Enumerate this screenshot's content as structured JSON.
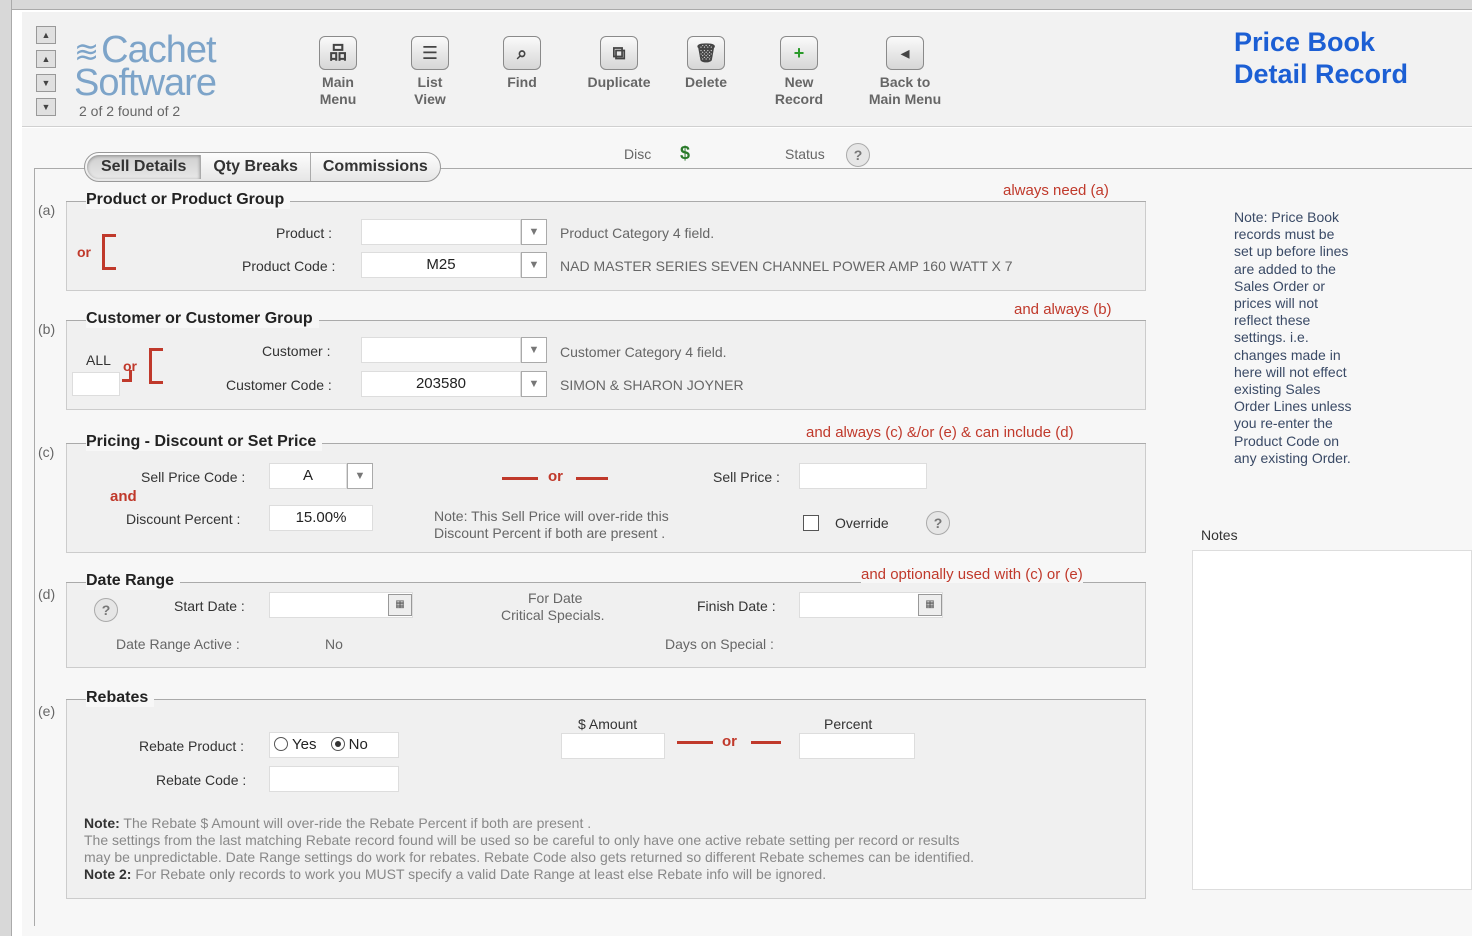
{
  "header": {
    "logo_line1": "Cachet",
    "logo_line2": "Software",
    "found_text": "2 of 2 found of 2",
    "toolbar": {
      "main_menu": [
        "Main",
        "Menu"
      ],
      "list_view": [
        "List",
        "View"
      ],
      "find": "Find",
      "duplicate": "Duplicate",
      "delete": "Delete",
      "new_record": [
        "New",
        "Record"
      ],
      "back_main_menu": [
        "Back to",
        "Main Menu"
      ]
    },
    "title_line1": "Price Book",
    "title_line2": "Detail Record",
    "disc_label": "Disc",
    "status_label": "Status"
  },
  "tabs": [
    "Sell Details",
    "Qty Breaks",
    "Commissions"
  ],
  "sections": {
    "a": {
      "tag": "(a)",
      "title": "Product or Product Group",
      "rule": "always need (a)",
      "or": "or",
      "product_label": "Product :",
      "product_value": "",
      "product_hint": "Product Category 4 field.",
      "code_label": "Product Code :",
      "code_value": "M25",
      "code_desc": "NAD MASTER SERIES SEVEN CHANNEL POWER AMP 160 WATT X 7"
    },
    "b": {
      "tag": "(b)",
      "title": "Customer or Customer Group",
      "rule": "and always (b)",
      "all_label": "ALL",
      "or": "or",
      "customer_label": "Customer :",
      "customer_value": "",
      "customer_hint": "Customer Category 4 field.",
      "code_label": "Customer Code :",
      "code_value": "203580",
      "code_desc": "SIMON & SHARON JOYNER"
    },
    "c": {
      "tag": "(c)",
      "title": "Pricing - Discount or Set Price",
      "rule": "and always (c) &/or (e) & can include (d)",
      "sell_price_code_label": "Sell Price Code :",
      "sell_price_code_value": "A",
      "and": "and",
      "discount_label": "Discount Percent :",
      "discount_value": "15.00%",
      "or": "or",
      "sell_price_label": "Sell Price :",
      "sell_price_value": "",
      "note_line1": "Note: This Sell Price will over-ride this",
      "note_line2": "Discount Percent if both are present .",
      "override_label": "Override",
      "override_checked": false
    },
    "d": {
      "tag": "(d)",
      "title": "Date Range",
      "rule": "and optionally used with (c) or (e)",
      "start_label": "Start Date :",
      "start_value": "",
      "middle_line1": "For Date",
      "middle_line2": "Critical Specials.",
      "finish_label": "Finish Date :",
      "finish_value": "",
      "active_label": "Date Range Active :",
      "active_value": "No",
      "days_label": "Days on Special :",
      "days_value": ""
    },
    "e": {
      "tag": "(e)",
      "title": "Rebates",
      "amount_label": "$ Amount",
      "amount_value": "",
      "or": "or",
      "percent_label": "Percent",
      "percent_value": "",
      "rebate_product_label": "Rebate Product :",
      "yes_label": "Yes",
      "no_label": "No",
      "rebate_product_value": "No",
      "rebate_code_label": "Rebate Code :",
      "rebate_code_value": "",
      "note_label": "Note:",
      "note_text": "The Rebate $ Amount will over-ride the Rebate Percent if both are present .",
      "note_line2": "The settings from the last matching Rebate record found will be used so be careful to only have one active rebate setting per record or results",
      "note_line3": "may be unpredictable.  Date Range settings do work for rebates.  Rebate Code also gets returned so different Rebate schemes can be identified.",
      "note2_label": "Note 2:",
      "note2_text": "For Rebate only records to work you MUST specify a valid Date Range at least else Rebate info will be ignored."
    }
  },
  "side_note": [
    "Note: Price Book",
    "records must be",
    "set up before lines",
    "are added to the",
    "Sales Order or",
    "prices will not",
    "reflect these",
    "settings. i.e.",
    "changes made in",
    "here will not effect",
    "existing Sales",
    "Order Lines unless",
    "you re-enter the",
    "Product Code on",
    "any existing Order."
  ],
  "notes_label": "Notes",
  "notes_value": "",
  "colors": {
    "title_blue": "#1c5fd4",
    "rule_red": "#c0392b",
    "logo_blue": "#7da4c9"
  }
}
